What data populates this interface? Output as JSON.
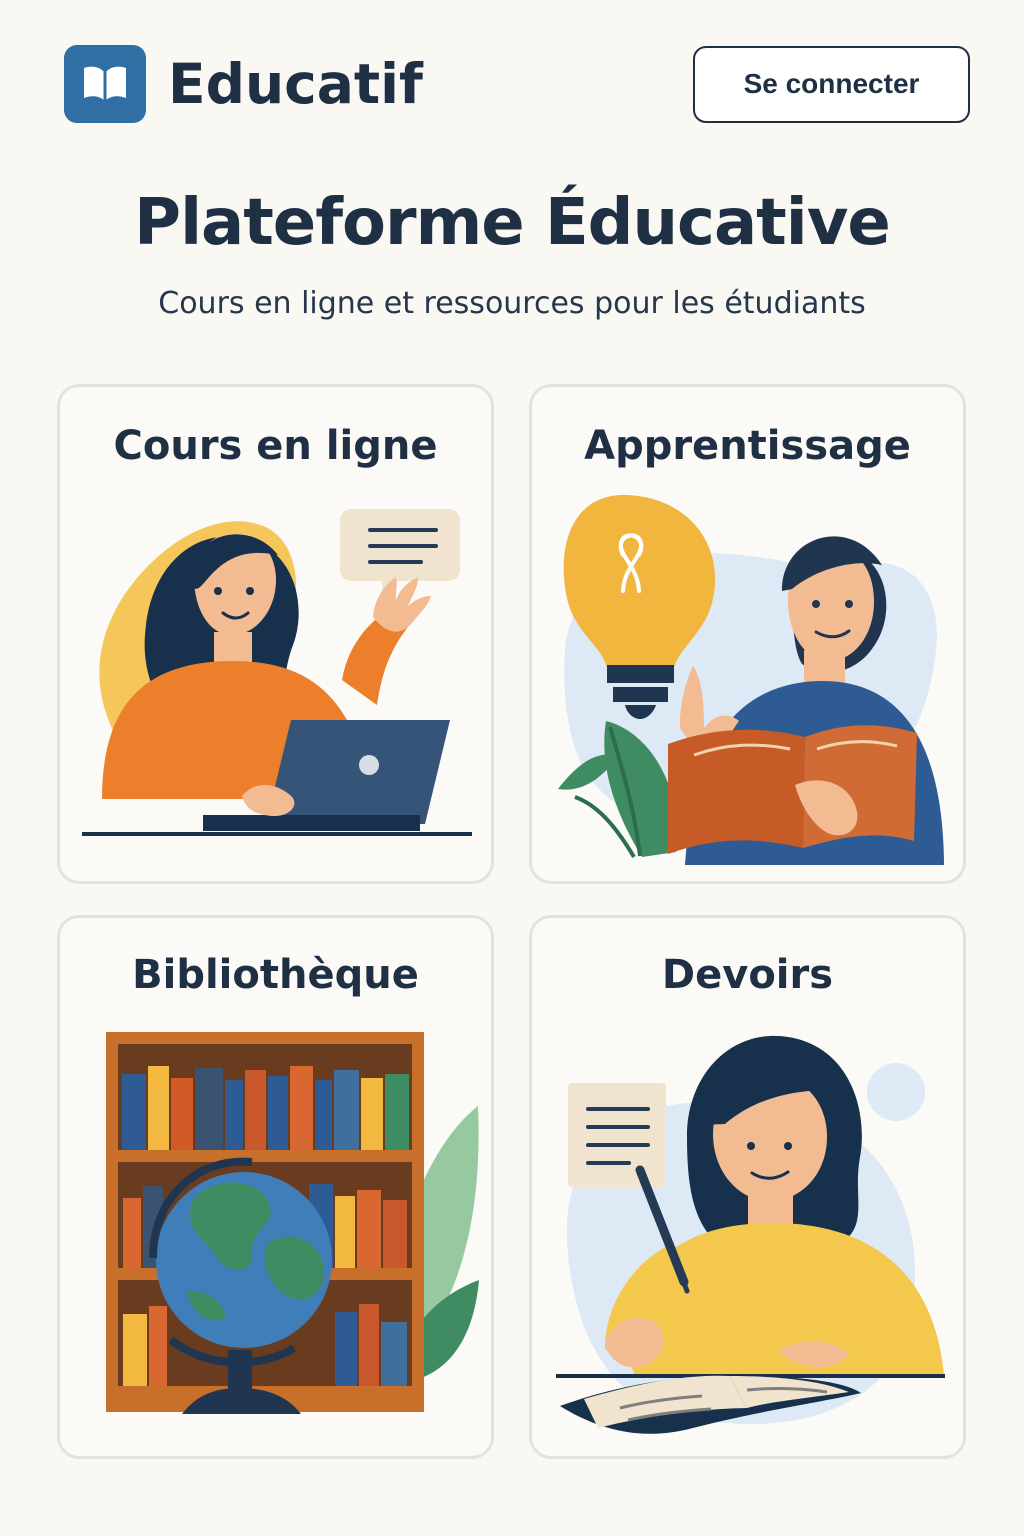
{
  "header": {
    "logo_icon": "book-icon",
    "brand_name": "Educatif",
    "login_label": "Se connecter"
  },
  "hero": {
    "title": "Plateforme Éducative",
    "subtitle": "Cours en ligne et ressources pour les étudiants"
  },
  "cards": [
    {
      "title": "Cours en ligne",
      "illustration": "student-laptop-illustration"
    },
    {
      "title": "Apprentissage",
      "illustration": "lightbulb-reading-illustration"
    },
    {
      "title": "Bibliothèque",
      "illustration": "bookshelf-globe-illustration"
    },
    {
      "title": "Devoirs",
      "illustration": "writing-homework-illustration"
    }
  ],
  "colors": {
    "primary": "#2f6fa4",
    "text": "#1f2f44",
    "background": "#faf8f3",
    "card_border": "#e2e2e2",
    "accent_orange": "#ec7f2b",
    "accent_yellow": "#f3b83f",
    "accent_blue": "#2f5b95",
    "accent_green": "#3f8c63"
  }
}
